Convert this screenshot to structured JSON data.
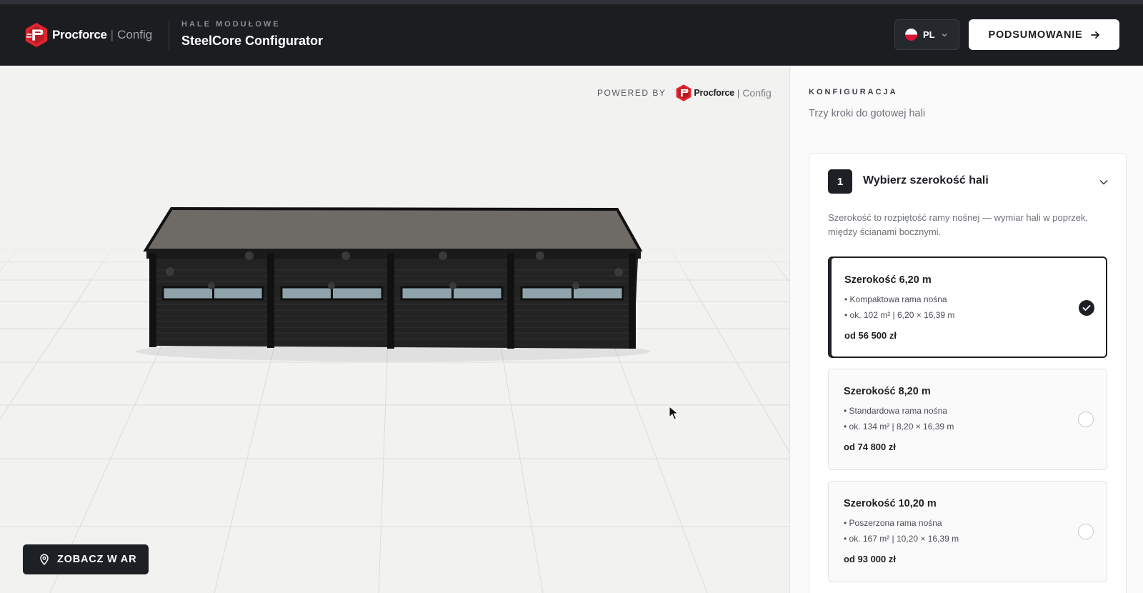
{
  "header": {
    "brand": "Procforce",
    "brand_suffix": "Config",
    "kicker": "HALE MODUŁOWE",
    "app_title": "SteelCore Configurator",
    "language": "PL",
    "summary_label": "PODSUMOWANIE"
  },
  "viewport": {
    "powered_by": "POWERED BY",
    "powered_brand": "Procforce",
    "powered_suffix": "Config",
    "ar_label": "ZOBACZ W AR"
  },
  "sidebar": {
    "kicker": "KONFIGURACJA",
    "subtitle": "Trzy kroki do gotowej hali",
    "step": {
      "number": "1",
      "title": "Wybierz szerokość hali",
      "description": "Szerokość to rozpiętość ramy nośnej — wymiar hali w poprzek, między ścianami bocznymi.",
      "options": [
        {
          "title": "Szerokość 6,20 m",
          "bullet1": "• Kompaktowa rama nośna",
          "bullet2": "• ok. 102 m² | 6,20 × 16,39 m",
          "price": "od 56 500 zł",
          "selected": true
        },
        {
          "title": "Szerokość 8,20 m",
          "bullet1": "• Standardowa rama nośna",
          "bullet2": "• ok. 134 m² | 8,20 × 16,39 m",
          "price": "od 74 800 zł",
          "selected": false
        },
        {
          "title": "Szerokość 10,20 m",
          "bullet1": "• Poszerzona rama nośna",
          "bullet2": "• ok. 167 m² | 10,20 × 16,39 m",
          "price": "od 93 000 zł",
          "selected": false
        }
      ]
    }
  },
  "colors": {
    "header_bg": "#1b1d21",
    "brand_red": "#e0252e",
    "accent_dark": "#1d2024",
    "viewport_bg": "#f2f2f1"
  },
  "icons": [
    "procforce-logo-icon",
    "flag-pl-icon",
    "chevron-down-icon",
    "arrow-right-icon",
    "map-pin-icon",
    "check-icon",
    "cursor-icon"
  ]
}
